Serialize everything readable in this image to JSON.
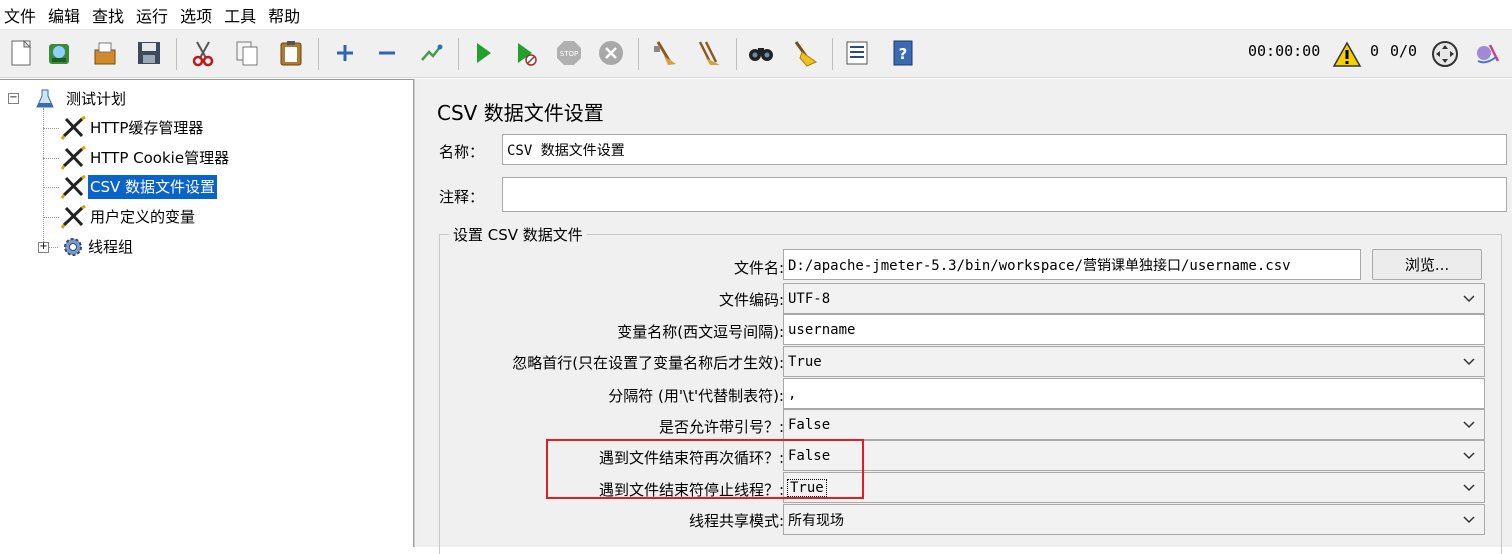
{
  "menu": [
    "文件",
    "编辑",
    "查找",
    "运行",
    "选项",
    "工具",
    "帮助"
  ],
  "toolbar": {
    "icons": [
      "new-icon",
      "templates-icon",
      "open-icon",
      "save-icon",
      "cut-icon",
      "copy-icon",
      "paste-icon",
      "expand-icon",
      "collapse-icon",
      "toggle-icon",
      "start-icon",
      "start-no-pause-icon",
      "stop-icon",
      "shutdown-icon",
      "clear-icon",
      "clear-all-icon",
      "search-icon",
      "reset-search-icon",
      "function-helper-icon",
      "help-icon"
    ],
    "timer": "00:00:00",
    "warning_count": "0",
    "threads": "0/0"
  },
  "tree": {
    "root": "测试计划",
    "items": [
      "HTTP缓存管理器",
      "HTTP Cookie管理器",
      "CSV 数据文件设置",
      "用户定义的变量",
      "线程组"
    ],
    "selected_index": 2
  },
  "panel": {
    "title": "CSV 数据文件设置",
    "name_label": "名称：",
    "name_value": "CSV 数据文件设置",
    "comment_label": "注释：",
    "comment_value": "",
    "group_title": "设置 CSV 数据文件",
    "filename_label": "文件名:",
    "filename_value": "D:/apache-jmeter-5.3/bin/workspace/营销课单独接口/username.csv",
    "browse_label": "浏览...",
    "encoding_label": "文件编码:",
    "encoding_value": "UTF-8",
    "varnames_label": "变量名称(西文逗号间隔):",
    "varnames_value": "username",
    "ignore_first_label": "忽略首行(只在设置了变量名称后才生效):",
    "ignore_first_value": "True",
    "delimiter_label": "分隔符 (用'\\t'代替制表符):",
    "delimiter_value": ",",
    "quoted_label": "是否允许带引号？:",
    "quoted_value": "False",
    "recycle_label": "遇到文件结束符再次循环？:",
    "recycle_value": "False",
    "stop_thread_label": "遇到文件结束符停止线程？:",
    "stop_thread_value": "True",
    "sharing_label": "线程共享模式:",
    "sharing_value": "所有现场"
  },
  "colors": {
    "selection": "#0a64c8",
    "highlight_box": "#e02020"
  }
}
